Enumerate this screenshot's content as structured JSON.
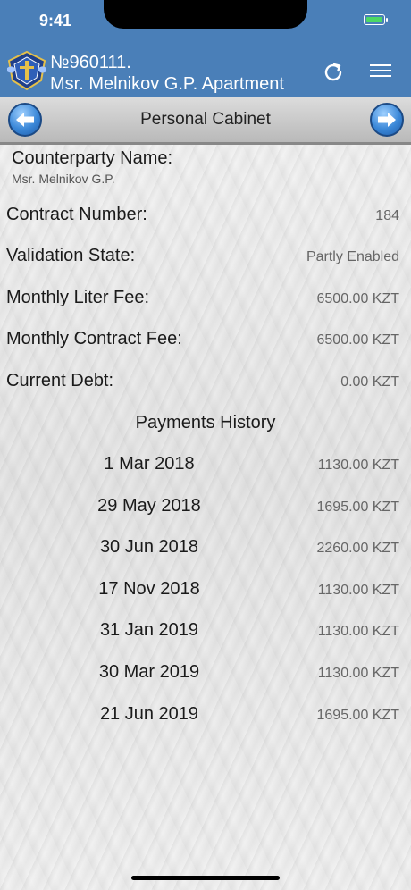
{
  "status_bar": {
    "time": "9:41"
  },
  "header": {
    "title_line1": "№960111.",
    "title_line2": "Msr. Melnikov G.P. Apartment"
  },
  "nav": {
    "title": "Personal Cabinet"
  },
  "counterparty": {
    "label": "Counterparty Name:",
    "value": "Msr. Melnikov G.P."
  },
  "fields": [
    {
      "label": "Contract Number:",
      "value": "184"
    },
    {
      "label": "Validation State:",
      "value": "Partly Enabled"
    },
    {
      "label": "Monthly Liter Fee:",
      "value": "6500.00 KZT"
    },
    {
      "label": "Monthly Contract Fee:",
      "value": "6500.00 KZT"
    },
    {
      "label": "Current Debt:",
      "value": "0.00 KZT"
    }
  ],
  "payments_history": {
    "title": "Payments History",
    "items": [
      {
        "date": "1 Mar 2018",
        "amount": "1130.00 KZT"
      },
      {
        "date": "29 May 2018",
        "amount": "1695.00 KZT"
      },
      {
        "date": "30 Jun 2018",
        "amount": "2260.00 KZT"
      },
      {
        "date": "17 Nov 2018",
        "amount": "1130.00 KZT"
      },
      {
        "date": "31 Jan 2019",
        "amount": "1130.00 KZT"
      },
      {
        "date": "30 Mar 2019",
        "amount": "1130.00 KZT"
      },
      {
        "date": "21 Jun 2019",
        "amount": "1695.00 KZT"
      }
    ]
  },
  "colors": {
    "header": "#4a7fb8",
    "accent_arrow": "#3b88d8",
    "battery": "#4cd964"
  },
  "icons": {
    "logo": "emblem-shield-icon",
    "refresh": "refresh-icon",
    "menu": "hamburger-menu-icon",
    "back": "arrow-left-icon",
    "forward": "arrow-right-icon"
  }
}
